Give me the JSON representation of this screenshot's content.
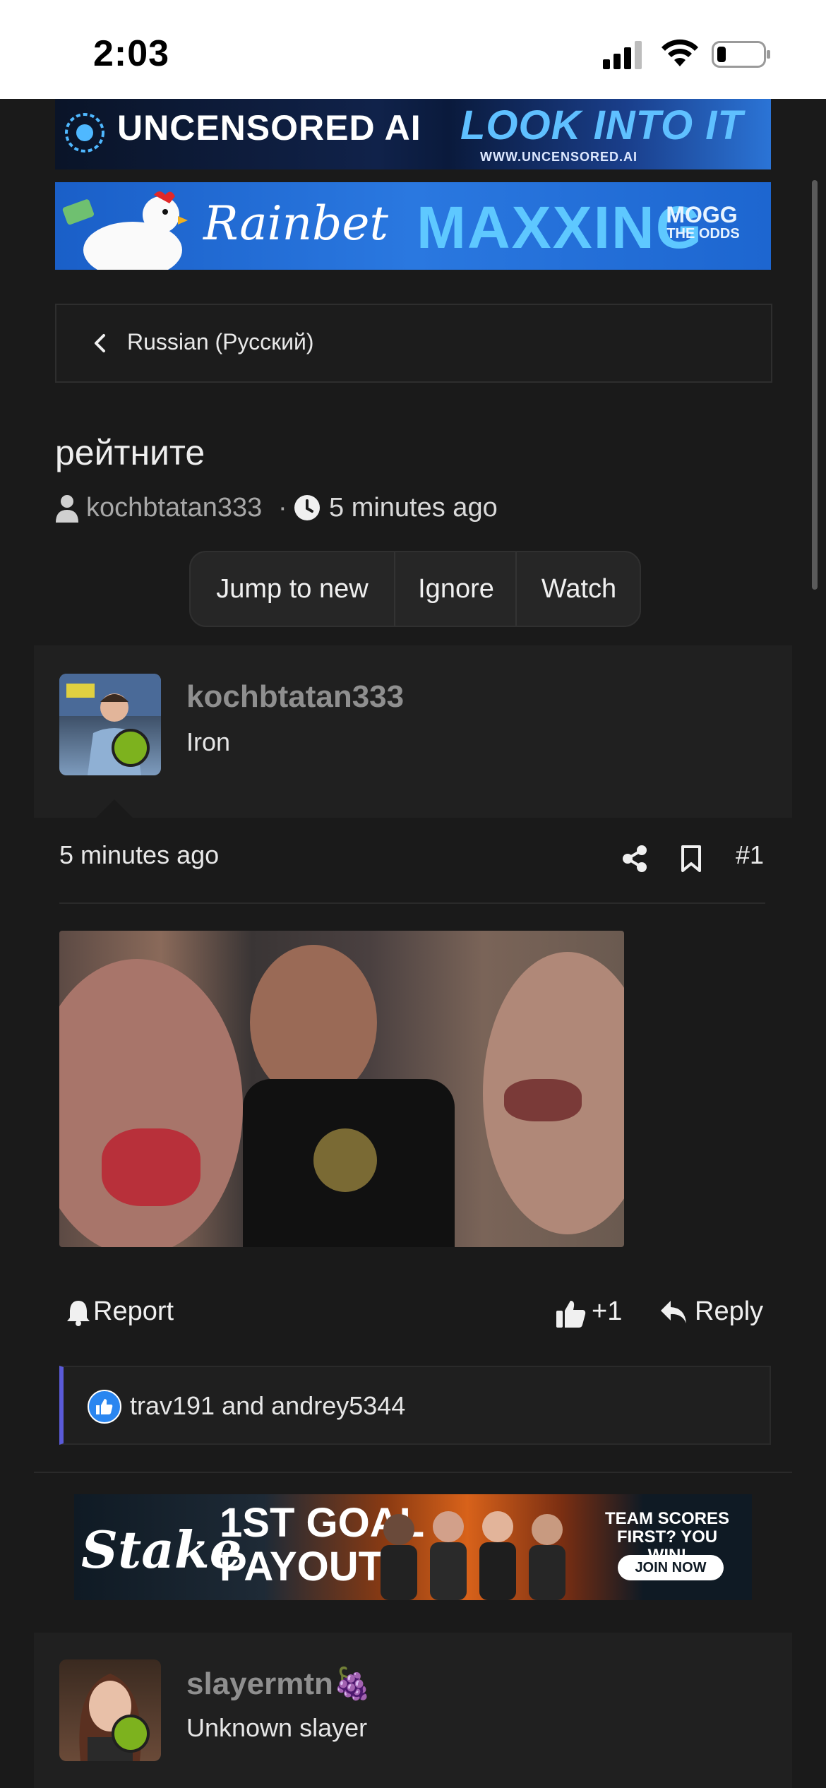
{
  "status_bar": {
    "time": "2:03"
  },
  "banners": {
    "ai": {
      "left_text": "UNCENSORED AI",
      "right_text": "LOOK INTO IT",
      "url": "WWW.UNCENSORED.AI"
    },
    "rainbet": {
      "logo": "Rainbet",
      "headline": "MAXXING",
      "tag_line1": "MOGG",
      "tag_line2": "THE ODDS"
    },
    "stake": {
      "logo": "Stake",
      "headline_line1": "1ST GOAL",
      "headline_line2": "PAYOUT",
      "side_line1": "TEAM SCORES",
      "side_line2": "FIRST? YOU WIN!",
      "cta": "JOIN NOW"
    }
  },
  "breadcrumb": {
    "label": "Russian (Русский)"
  },
  "thread": {
    "title": "рейтните",
    "author": "kochbtatan333",
    "separator": "·",
    "time_ago": "5 minutes ago",
    "buttons": {
      "jump": "Jump to new",
      "ignore": "Ignore",
      "watch": "Watch"
    }
  },
  "post1": {
    "username": "kochbtatan333",
    "user_title": "Iron",
    "time_ago": "5 minutes ago",
    "post_number": "#1",
    "actions": {
      "report": "Report",
      "like": "+1",
      "reply": "Reply"
    },
    "reactions_text": "trav191 and andrey5344"
  },
  "post2": {
    "username": "slayermtn🍇",
    "user_title": "Unknown slayer"
  },
  "icons": [
    "signal-icon",
    "wifi-icon",
    "battery-icon",
    "chevron-left-icon",
    "user-icon",
    "clock-icon",
    "share-icon",
    "bookmark-icon",
    "bell-icon",
    "thumbs-up-icon",
    "reply-icon"
  ],
  "colors": {
    "background": "#1a1a1a",
    "online": "#7db21e",
    "reaction_bar": "#5a5ad8",
    "like_badge": "#2a86f0"
  }
}
